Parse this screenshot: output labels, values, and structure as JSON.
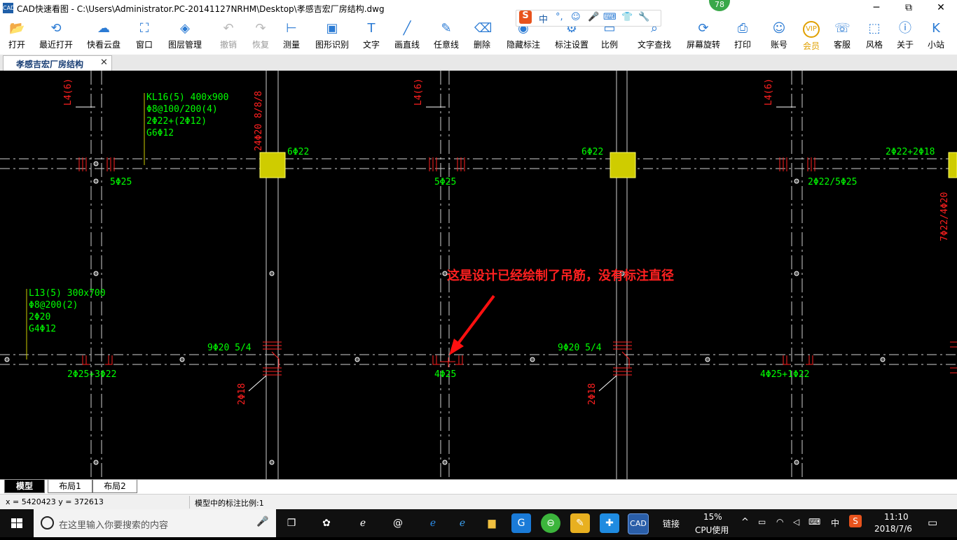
{
  "window": {
    "app_icon": "CAD",
    "title": "CAD快速看图 - C:\\Users\\Administrator.PC-20141127NRHM\\Desktop\\孝感吉宏厂房结构.dwg",
    "minimize_icon": "─",
    "restore_icon": "⧉",
    "close_icon": "✕",
    "notification_badge": "78"
  },
  "toolbar": {
    "items": [
      {
        "id": "open",
        "label": "打开",
        "icon": "📂",
        "enabled": true
      },
      {
        "id": "recent",
        "label": "最近打开",
        "icon": "⟲",
        "enabled": true
      },
      {
        "id": "cloud",
        "label": "快看云盘",
        "icon": "☁",
        "enabled": true
      },
      {
        "id": "window",
        "label": "窗口",
        "icon": "⛶",
        "enabled": true
      },
      {
        "id": "layers",
        "label": "图层管理",
        "icon": "◈",
        "enabled": true
      },
      {
        "id": "undo",
        "label": "撤销",
        "icon": "↶",
        "enabled": false
      },
      {
        "id": "redo",
        "label": "恢复",
        "icon": "↷",
        "enabled": false
      },
      {
        "id": "measure",
        "label": "测量",
        "icon": "⊢",
        "enabled": true
      },
      {
        "id": "shape",
        "label": "图形识别",
        "icon": "▣",
        "enabled": true
      },
      {
        "id": "text",
        "label": "文字",
        "icon": "T",
        "enabled": true
      },
      {
        "id": "line",
        "label": "画直线",
        "icon": "╱",
        "enabled": true
      },
      {
        "id": "freeline",
        "label": "任意线",
        "icon": "✎",
        "enabled": true
      },
      {
        "id": "erase",
        "label": "删除",
        "icon": "⌫",
        "enabled": true
      },
      {
        "id": "hide",
        "label": "隐藏标注",
        "icon": "◉",
        "enabled": true
      },
      {
        "id": "dimset",
        "label": "标注设置",
        "icon": "⚙",
        "enabled": true
      },
      {
        "id": "ratio",
        "label": "比例",
        "icon": "▭",
        "enabled": true
      },
      {
        "id": "findtext",
        "label": "文字查找",
        "icon": "⌕",
        "enabled": true
      },
      {
        "id": "rotate",
        "label": "屏幕旋转",
        "icon": "⟳",
        "enabled": true
      },
      {
        "id": "print",
        "label": "打印",
        "icon": "⎙",
        "enabled": true
      },
      {
        "id": "account",
        "label": "账号",
        "icon": "☺",
        "enabled": true
      },
      {
        "id": "vip",
        "label": "会员",
        "icon": "VIP",
        "enabled": true
      },
      {
        "id": "service",
        "label": "客服",
        "icon": "☏",
        "enabled": true
      },
      {
        "id": "style",
        "label": "风格",
        "icon": "⬚",
        "enabled": true
      },
      {
        "id": "about",
        "label": "关于",
        "icon": "ⓘ",
        "enabled": true
      },
      {
        "id": "xiaozhan",
        "label": "小站",
        "icon": "K",
        "enabled": true
      }
    ],
    "ime": {
      "logo": "S",
      "lang": "中",
      "punct": "°,",
      "emoji": "☺",
      "mic": "🎤",
      "keyboard": "⌨",
      "skin": "👕",
      "tools": "🔧"
    }
  },
  "document_tab": {
    "label": "孝感吉宏厂房结构",
    "close": "✕"
  },
  "drawing": {
    "annotation_colors": {
      "green": "#00ff00",
      "red": "#ff0000",
      "yellow": "#cccc00",
      "white": "#e8e8e8"
    },
    "beam_kl16": [
      "KL16(5) 400x900",
      "Φ8@100/200(4)",
      "2Φ22+(2Φ12)",
      "G6Φ12"
    ],
    "beam_l13": [
      "L13(5) 300x700",
      "Φ8@200(2)",
      "2Φ20",
      "G4Φ12"
    ],
    "labels_top": [
      "5Φ25",
      "6Φ22",
      "5Φ25",
      "6Φ22",
      "2Φ22/5Φ25",
      "2Φ22+2Φ18"
    ],
    "labels_l4": "L4(6)",
    "label_24": "24Φ20 8/8/8",
    "label_right_vertical": "7Φ22/4Φ20",
    "labels_bottom": [
      "2Φ25+3Φ22",
      "9Φ20 5/4",
      "4Φ25",
      "9Φ20 5/4",
      "4Φ25+1Φ22"
    ],
    "label_2c18": "2Φ18",
    "callout": "这是设计已经绘制了吊筋，没有标注直径"
  },
  "layout_tabs": [
    "模型",
    "布局1",
    "布局2"
  ],
  "status": {
    "coords": "x = 5420423  y = 372613",
    "scale": "模型中的标注比例:1"
  },
  "taskbar": {
    "search_placeholder": "在这里输入你要搜索的内容",
    "tray_link": "链接",
    "cpu_percent": "15%",
    "cpu_label": "CPU使用",
    "ime": "中",
    "time": "11:10",
    "date": "2018/7/6"
  }
}
